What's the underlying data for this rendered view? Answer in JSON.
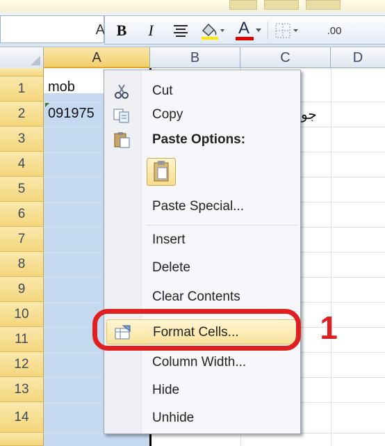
{
  "namebox": {
    "value": "A"
  },
  "toolbar": {
    "bold": "B",
    "italic": "I",
    "font_color_letter": "A",
    "decimal_label": ".00"
  },
  "columns": [
    "A",
    "B",
    "C",
    "D"
  ],
  "rows": [
    "1",
    "2",
    "3",
    "4",
    "5",
    "6",
    "7",
    "8",
    "9",
    "10",
    "11",
    "12",
    "13",
    "14"
  ],
  "cells": {
    "a1": "mob",
    "a2": "091975",
    "c2": "جو"
  },
  "context_menu": {
    "items": [
      {
        "label": "Cut",
        "icon": "scissors-icon"
      },
      {
        "label": "Copy",
        "icon": "copy-icon"
      },
      {
        "label": "Paste Options:",
        "icon": "paste-icon"
      },
      {
        "label": "Paste Special...",
        "icon": ""
      },
      {
        "label": "Insert",
        "icon": ""
      },
      {
        "label": "Delete",
        "icon": ""
      },
      {
        "label": "Clear Contents",
        "icon": ""
      },
      {
        "label": "Format Cells...",
        "icon": "format-cells-icon"
      },
      {
        "label": "Column Width...",
        "icon": ""
      },
      {
        "label": "Hide",
        "icon": ""
      },
      {
        "label": "Unhide",
        "icon": ""
      }
    ]
  },
  "annotation": {
    "number": "1",
    "color": "#e02020"
  },
  "colors": {
    "selection": "#c5d9f1",
    "row_header": "#f3d57b",
    "highlight": "#f9e39a"
  }
}
